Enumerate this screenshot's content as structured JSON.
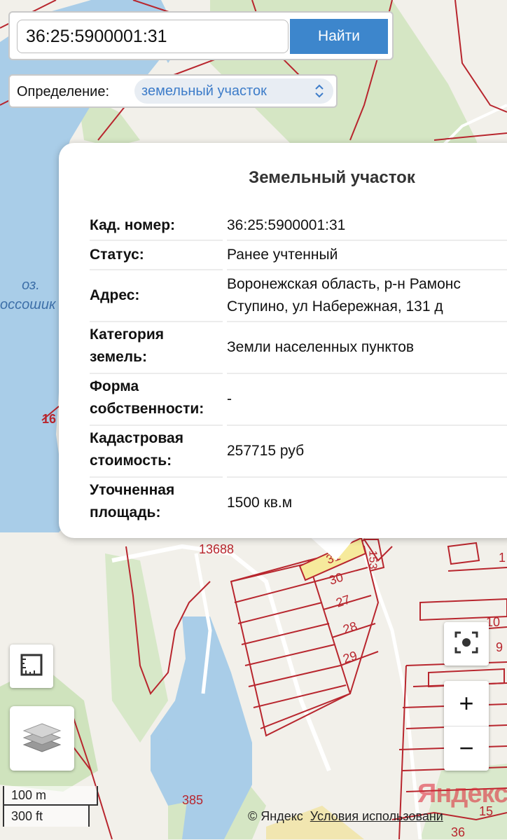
{
  "search": {
    "value": "36:25:5900001:31",
    "button_label": "Найти"
  },
  "definition": {
    "label": "Определение:",
    "selected": "земельный участок"
  },
  "popup": {
    "title": "Земельный участок",
    "rows": [
      {
        "key": "Кад. номер",
        "value": "36:25:5900001:31"
      },
      {
        "key": "Статус",
        "value": "Ранее учтенный"
      },
      {
        "key": "Адрес",
        "value_line1": "Воронежская область, р-н Рамонс",
        "value_line2": "Ступино, ул Набережная, 131 д"
      },
      {
        "key_line1": "Категория",
        "key_line2": "земель",
        "value": "Земли населенных пунктов"
      },
      {
        "key_line1": "Форма",
        "key_line2": "собственности",
        "value": "-"
      },
      {
        "key_line1": "Кадастровая",
        "key_line2": "стоимость",
        "value": "257715 руб"
      },
      {
        "key_line1": "Уточненная",
        "key_line2": "площадь",
        "value": "1500 кв.м"
      }
    ],
    "colon": ":"
  },
  "map_labels": {
    "lake_line1": "оз.",
    "lake_line2": "оссошик",
    "n16": "16",
    "n13688": "13688",
    "n385": "385",
    "p31": "31",
    "p30": "30",
    "p27": "27",
    "p28": "28",
    "p29": "29",
    "p10": "10",
    "p15": "15",
    "p36": "36",
    "p153": "153",
    "p1": "1",
    "p9": "9"
  },
  "scale": {
    "metric": "100 m",
    "imperial": "300 ft"
  },
  "attribution": {
    "copyright": "© Яндекс",
    "terms": "Условия использовани"
  },
  "logo": "Яндекс",
  "zoom": {
    "in": "+",
    "out": "−"
  },
  "icons": [
    "ruler-icon",
    "layers-icon",
    "locate-icon",
    "dropdown-chevron-icon"
  ],
  "colors": {
    "water": "#a9cde8",
    "green": "#cfe3bd",
    "boundary": "#b8262e",
    "selected_parcel": "#f6ea9c",
    "button": "#3d86cc"
  }
}
